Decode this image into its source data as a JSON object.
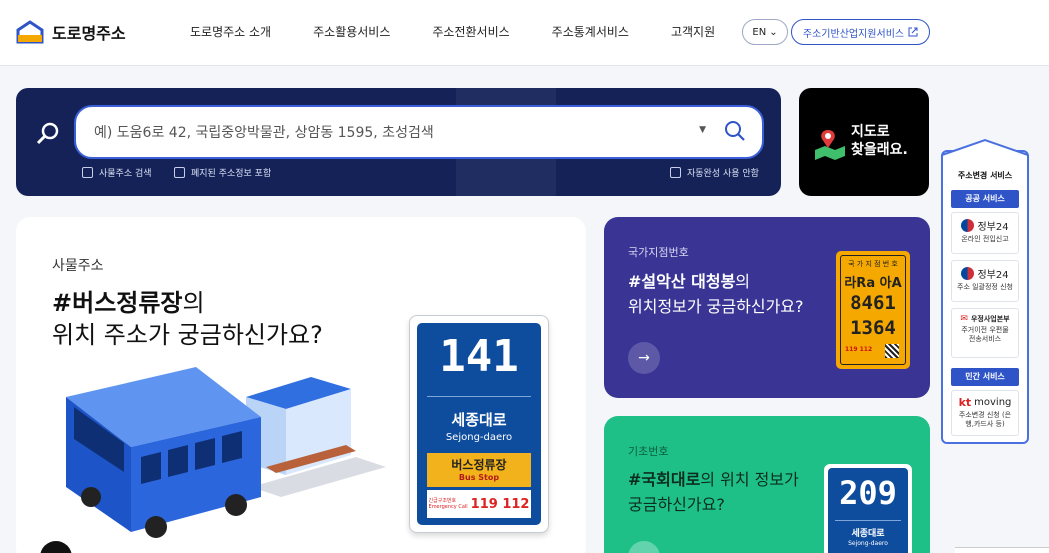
{
  "header": {
    "logo_text": "도로명주소",
    "nav": [
      "도로명주소 소개",
      "주소활용서비스",
      "주소전환서비스",
      "주소통계서비스",
      "고객지원"
    ],
    "lang": "EN",
    "ext_link": "주소기반산업지원서비스"
  },
  "search": {
    "placeholder": "예) 도움6로 42, 국립중앙박물관, 상암동 1595, 초성검색",
    "options": [
      "사물주소 검색",
      "폐지된 주소정보 포함"
    ],
    "autocomplete": "자동완성 사용 안함"
  },
  "map_card": {
    "line1": "지도로",
    "line2": "찾을래요."
  },
  "side": {
    "title": "주소변경 서비스",
    "public_badge": "공공 서비스",
    "private_badge": "민간 서비스",
    "items": [
      {
        "brand": "정부24",
        "sub": "온라인 전입신고"
      },
      {
        "brand": "정부24",
        "sub": "주소 일괄정정 신청"
      },
      {
        "brand": "우정사업본부",
        "sub": "주거이전 우편물 전송서비스"
      },
      {
        "brand": "moving",
        "sub": "주소변경 신청 (은행,카드사 등)"
      }
    ]
  },
  "big_card": {
    "label": "사물주소",
    "title_bold": "#버스정류장",
    "title_rest": "의",
    "title_line2": "위치 주소가 궁금하신가요?",
    "sign": {
      "number": "141",
      "road_ko": "세종대로",
      "road_en": "Sejong-daero",
      "bus_ko": "버스정류장",
      "bus_en": "Bus Stop",
      "emg_ko": "긴급구조번호",
      "emg_en": "Emergency Call",
      "emg_nums": "119 112"
    }
  },
  "purple_card": {
    "label": "국가지점번호",
    "title_bold": "#설악산 대청봉",
    "title_rest": "의",
    "title_line2": "위치정보가 궁금하신가요?",
    "arrow": "→",
    "plate": {
      "top": "국 가 지 점 번 호",
      "row1": "라Ra 아A",
      "row2": "8461",
      "row3": "1364",
      "emg": "119 112"
    }
  },
  "green_card": {
    "label": "기초번호",
    "title_bold": "#국회대로",
    "title_rest": "의 위치 정보가",
    "title_line2": "궁금하신가요?",
    "sign": {
      "number": "209",
      "road_ko": "세종대로",
      "road_en": "Sejong-daero"
    }
  }
}
